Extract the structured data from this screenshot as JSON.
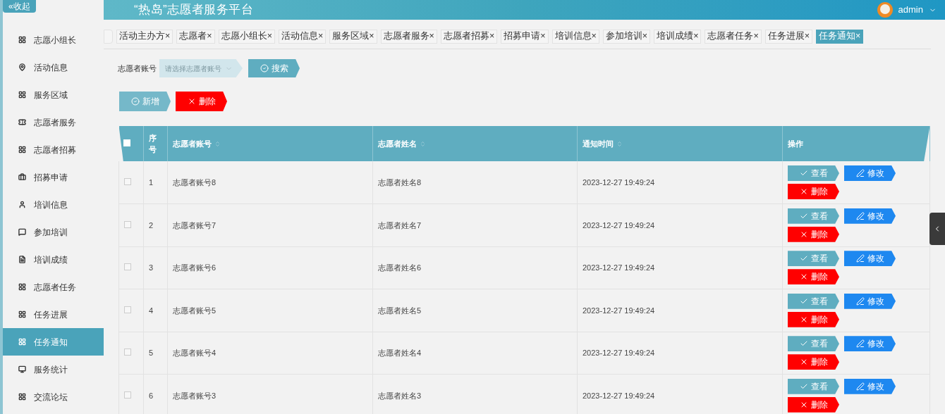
{
  "header": {
    "collapse_label": "«收起",
    "title": "“热岛”志愿者服务平台",
    "user": "admin"
  },
  "sidebar": {
    "items": [
      {
        "label": "志愿小组长",
        "kind": "grid",
        "selected": false
      },
      {
        "label": "活动信息",
        "kind": "pin",
        "selected": false
      },
      {
        "label": "服务区域",
        "kind": "grid",
        "selected": false
      },
      {
        "label": "志愿者服务",
        "kind": "ticket",
        "selected": false
      },
      {
        "label": "志愿者招募",
        "kind": "grid",
        "selected": false
      },
      {
        "label": "招募申请",
        "kind": "case",
        "selected": false
      },
      {
        "label": "培训信息",
        "kind": "person",
        "selected": false
      },
      {
        "label": "参加培训",
        "kind": "chat",
        "selected": false
      },
      {
        "label": "培训成绩",
        "kind": "doc",
        "selected": false
      },
      {
        "label": "志愿者任务",
        "kind": "grid",
        "selected": false
      },
      {
        "label": "任务进展",
        "kind": "grid",
        "selected": false
      },
      {
        "label": "任务通知",
        "kind": "grid",
        "selected": true
      },
      {
        "label": "服务统计",
        "kind": "monitor",
        "selected": false
      },
      {
        "label": "交流论坛",
        "kind": "grid",
        "selected": false
      }
    ]
  },
  "tabs": [
    {
      "label": "活动主办方×",
      "selected": false
    },
    {
      "label": "志愿者×",
      "selected": false
    },
    {
      "label": "志愿小组长×",
      "selected": false
    },
    {
      "label": "活动信息×",
      "selected": false
    },
    {
      "label": "服务区域×",
      "selected": false
    },
    {
      "label": "志愿者服务×",
      "selected": false
    },
    {
      "label": "志愿者招募×",
      "selected": false
    },
    {
      "label": "招募申请×",
      "selected": false
    },
    {
      "label": "培训信息×",
      "selected": false
    },
    {
      "label": "参加培训×",
      "selected": false
    },
    {
      "label": "培训成绩×",
      "selected": false
    },
    {
      "label": "志愿者任务×",
      "selected": false
    },
    {
      "label": "任务进展×",
      "selected": false
    },
    {
      "label": "任务通知×",
      "selected": true
    }
  ],
  "search": {
    "label": "志愿者账号",
    "placeholder": "请选择志愿者账号",
    "button": "搜索"
  },
  "actions": {
    "add": "新增",
    "delete": "删除"
  },
  "table": {
    "select_all_checked": false,
    "columns": [
      "序号",
      "志愿者账号",
      "志愿者姓名",
      "通知时间",
      "操作"
    ],
    "rows": [
      {
        "checked": false,
        "cells": [
          "1",
          "志愿者账号8",
          "志愿者姓名8",
          "2023-12-27 19:49:24"
        ],
        "buttons": [
          "查看",
          "修改",
          "删除"
        ]
      },
      {
        "checked": false,
        "cells": [
          "2",
          "志愿者账号7",
          "志愿者姓名7",
          "2023-12-27 19:49:24"
        ],
        "buttons": [
          "查看",
          "修改",
          "删除"
        ]
      },
      {
        "checked": false,
        "cells": [
          "3",
          "志愿者账号6",
          "志愿者姓名6",
          "2023-12-27 19:49:24"
        ],
        "buttons": [
          "查看",
          "修改",
          "删除"
        ]
      },
      {
        "checked": false,
        "cells": [
          "4",
          "志愿者账号5",
          "志愿者姓名5",
          "2023-12-27 19:49:24"
        ],
        "buttons": [
          "查看",
          "修改",
          "删除"
        ]
      },
      {
        "checked": false,
        "cells": [
          "5",
          "志愿者账号4",
          "志愿者姓名4",
          "2023-12-27 19:49:24"
        ],
        "buttons": [
          "查看",
          "修改",
          "删除"
        ]
      },
      {
        "checked": false,
        "cells": [
          "6",
          "志愿者账号3",
          "志愿者姓名3",
          "2023-12-27 19:49:24"
        ],
        "buttons": [
          "查看",
          "修改",
          "删除"
        ]
      }
    ]
  }
}
